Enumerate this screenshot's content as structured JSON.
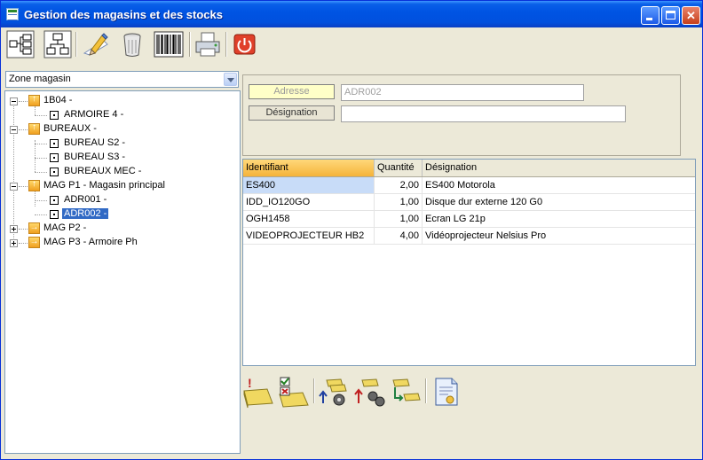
{
  "window": {
    "title": "Gestion des magasins et des stocks"
  },
  "toolbar": {
    "icons": [
      "tree-view-icon",
      "hierarchy-icon",
      "edit-pencil-icon",
      "trash-icon",
      "barcode-icon",
      "printer-icon",
      "power-icon"
    ]
  },
  "zone_combo": {
    "value": "Zone magasin"
  },
  "tree": {
    "nodes": [
      {
        "label": "1B04 -"
      },
      {
        "label": "ARMOIRE 4 -"
      },
      {
        "label": "BUREAUX -"
      },
      {
        "label": "BUREAU S2 -"
      },
      {
        "label": "BUREAU S3 -"
      },
      {
        "label": "BUREAUX MEC -"
      },
      {
        "label": "MAG P1 - Magasin principal"
      },
      {
        "label": "ADR001 -"
      },
      {
        "label": "ADR002 -"
      },
      {
        "label": "MAG P2 -"
      },
      {
        "label": "MAG P3 - Armoire Ph"
      }
    ]
  },
  "details": {
    "adresse_label": "Adresse",
    "adresse_value": "ADR002",
    "designation_label": "Désignation",
    "designation_value": ""
  },
  "grid": {
    "headers": [
      "Identifiant",
      "Quantité",
      "Désignation"
    ],
    "rows": [
      [
        "ES400",
        "2,00",
        "ES400 Motorola"
      ],
      [
        "IDD_IO120GO",
        "1,00",
        "Disque dur externe 120 G0"
      ],
      [
        "OGH1458",
        "1,00",
        "Ecran LG 21p"
      ],
      [
        "VIDEOPROJECTEUR HB2",
        "4,00",
        "Vidéoprojecteur Nelsius Pro"
      ]
    ]
  },
  "bottom_toolbar": {
    "icons": [
      "add-stock-icon",
      "validate-stock-icon",
      "stock-in-icon",
      "stock-out-icon",
      "stock-transfer-icon",
      "report-icon"
    ]
  },
  "colors": {
    "title_blue": "#0054e3",
    "selection": "#316ac5",
    "header_active": "#f5b33a"
  }
}
